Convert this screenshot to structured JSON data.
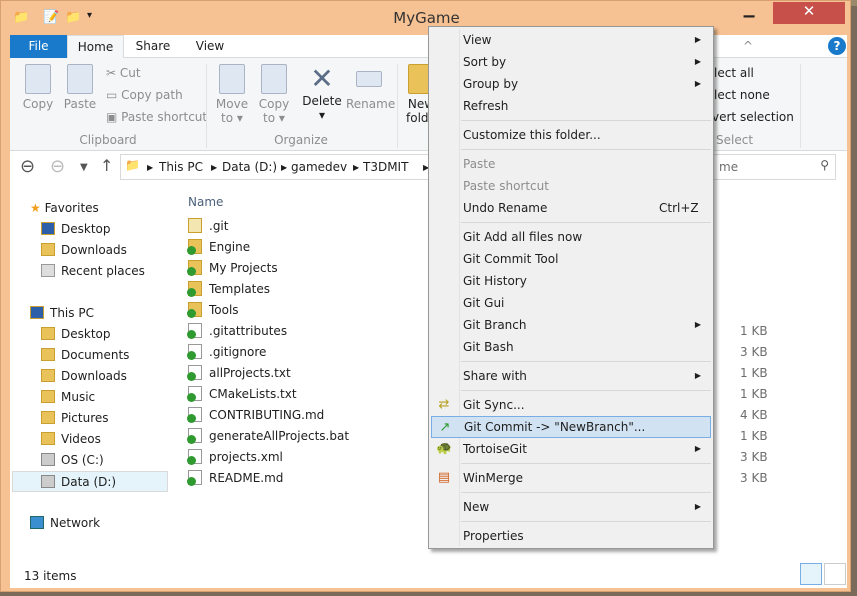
{
  "window": {
    "title": "MyGame",
    "minimize": "▁",
    "maximize": "☐",
    "close": "✕",
    "help": "?",
    "collapse": "^"
  },
  "ribbon": {
    "tabs": [
      "File",
      "Home",
      "Share",
      "View"
    ],
    "clipboard": {
      "copy": "Copy",
      "paste": "Paste",
      "cut": "Cut",
      "copy_path": "Copy path",
      "paste_shortcut": "Paste shortcut",
      "group": "Clipboard"
    },
    "organize": {
      "move_to": "Move to ▾",
      "copy_to": "Copy to ▾",
      "delete": "Delete ▾",
      "rename": "Rename",
      "group": "Organize"
    },
    "new": {
      "new_folder": "New folder"
    },
    "select": {
      "select_all": "lect all",
      "select_none": "lect none",
      "invert": "vert selection",
      "group": "Select"
    }
  },
  "address": {
    "crumbs": [
      "This PC",
      "Data (D:)",
      "gamedev",
      "T3DMIT"
    ],
    "search_placeholder": "me"
  },
  "nav": {
    "favorites": "Favorites",
    "fav_items": [
      "Desktop",
      "Downloads",
      "Recent places"
    ],
    "this_pc": "This PC",
    "pc_items": [
      "Desktop",
      "Documents",
      "Downloads",
      "Music",
      "Pictures",
      "Videos",
      "OS (C:)",
      "Data (D:)"
    ],
    "network": "Network"
  },
  "files": {
    "header": "Name",
    "items": [
      {
        "name": ".git",
        "type": "folder",
        "size": ""
      },
      {
        "name": "Engine",
        "type": "folder-git",
        "size": ""
      },
      {
        "name": "My Projects",
        "type": "folder-git",
        "size": ""
      },
      {
        "name": "Templates",
        "type": "folder-git",
        "size": ""
      },
      {
        "name": "Tools",
        "type": "folder-git",
        "size": ""
      },
      {
        "name": ".gitattributes",
        "type": "file-git",
        "size": "1 KB"
      },
      {
        "name": ".gitignore",
        "type": "file-git",
        "size": "3 KB"
      },
      {
        "name": "allProjects.txt",
        "type": "file-git",
        "size": "1 KB"
      },
      {
        "name": "CMakeLists.txt",
        "type": "file-git",
        "size": "1 KB"
      },
      {
        "name": "CONTRIBUTING.md",
        "type": "file-git",
        "size": "4 KB"
      },
      {
        "name": "generateAllProjects.bat",
        "type": "file-git",
        "size": "1 KB"
      },
      {
        "name": "projects.xml",
        "type": "file-git",
        "size": "3 KB"
      },
      {
        "name": "README.md",
        "type": "file-git",
        "size": "3 KB"
      }
    ]
  },
  "status": {
    "count": "13 items"
  },
  "menu": {
    "items": [
      {
        "label": "View",
        "sub": true
      },
      {
        "label": "Sort by",
        "sub": true
      },
      {
        "label": "Group by",
        "sub": true
      },
      {
        "label": "Refresh"
      },
      {
        "sep": true
      },
      {
        "label": "Customize this folder..."
      },
      {
        "sep": true
      },
      {
        "label": "Paste",
        "disabled": true
      },
      {
        "label": "Paste shortcut",
        "disabled": true
      },
      {
        "label": "Undo Rename",
        "shortcut": "Ctrl+Z"
      },
      {
        "sep": true
      },
      {
        "label": "Git Add all files now"
      },
      {
        "label": "Git Commit Tool"
      },
      {
        "label": "Git History"
      },
      {
        "label": "Git Gui"
      },
      {
        "label": "Git Branch",
        "sub": true
      },
      {
        "label": "Git Bash"
      },
      {
        "sep": true
      },
      {
        "label": "Share with",
        "sub": true
      },
      {
        "sep": true
      },
      {
        "label": "Git Sync...",
        "icon": "git-sync-icon"
      },
      {
        "label": "Git Commit -> \"NewBranch\"...",
        "icon": "git-commit-icon",
        "highlight": true
      },
      {
        "label": "TortoiseGit",
        "icon": "tortoisegit-icon",
        "sub": true
      },
      {
        "sep": true
      },
      {
        "label": "WinMerge",
        "icon": "winmerge-icon"
      },
      {
        "sep": true
      },
      {
        "label": "New",
        "sub": true
      },
      {
        "sep": true
      },
      {
        "label": "Properties"
      }
    ]
  },
  "colors": {
    "frame": "#f6c193",
    "file_tab": "#1979ca",
    "close": "#c7504b",
    "highlight": "#d1e2f2"
  }
}
